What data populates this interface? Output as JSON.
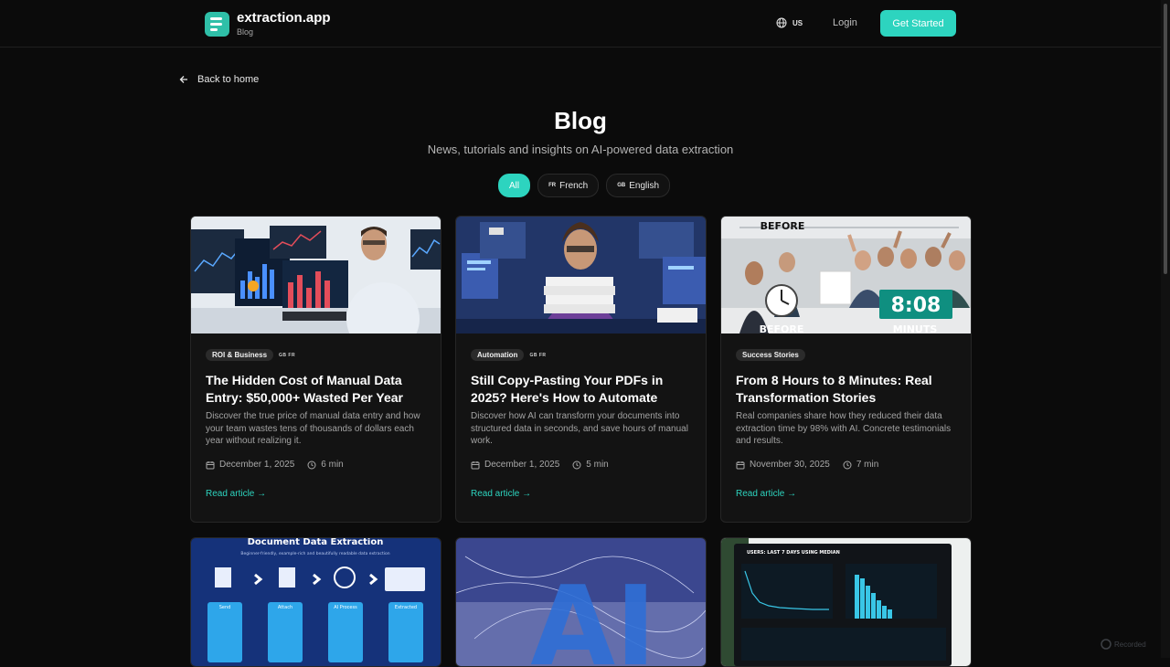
{
  "header": {
    "brand_name": "extraction.app",
    "brand_sub": "Blog",
    "lang_code": "US",
    "login_label": "Login",
    "cta_label": "Get Started"
  },
  "nav": {
    "back_label": "Back to home"
  },
  "page": {
    "title": "Blog",
    "subtitle": "News, tutorials and insights on AI-powered data extraction"
  },
  "filters": [
    {
      "flag": "",
      "label": "All",
      "active": true
    },
    {
      "flag": "FR",
      "label": "French",
      "active": false
    },
    {
      "flag": "GB",
      "label": "English",
      "active": false
    }
  ],
  "cards": [
    {
      "tag": "ROI & Business",
      "langs": "GB FR",
      "title": "The Hidden Cost of Manual Data Entry: $50,000+ Wasted Per Year",
      "excerpt": "Discover the true price of manual data entry and how your team wastes tens of thousands of dollars each year without realizing it.",
      "date": "December 1, 2025",
      "read_time": "6 min",
      "cta": "Read article →"
    },
    {
      "tag": "Automation",
      "langs": "GB FR",
      "title": "Still Copy-Pasting Your PDFs in 2025? Here's How to Automate",
      "excerpt": "Discover how AI can transform your documents into structured data in seconds, and save hours of manual work.",
      "date": "December 1, 2025",
      "read_time": "5 min",
      "cta": "Read article →"
    },
    {
      "tag": "Success Stories",
      "langs": "",
      "title": "From 8 Hours to 8 Minutes: Real Transformation Stories",
      "excerpt": "Real companies share how they reduced their data extraction time by 98% with AI. Concrete testimonials and results.",
      "date": "November 30, 2025",
      "read_time": "7 min",
      "cta": "Read article →",
      "image_text": {
        "before": "BEFORE",
        "clock": "8:08",
        "before_bottom": "BEFORE",
        "minutes": "MINUTS"
      }
    }
  ],
  "row2": {
    "card1_title": "Document Data Extraction",
    "card1_sub": "Beginner-friendly, example-rich and beautifully readable data extraction",
    "card1_steps": [
      "Send",
      "Attach",
      "AI Process",
      "Extracted"
    ],
    "card2_label": "AI",
    "card3_title": "USERS: LAST 7 DAYS USING MEDIAN"
  },
  "watermark": "Recorded"
}
